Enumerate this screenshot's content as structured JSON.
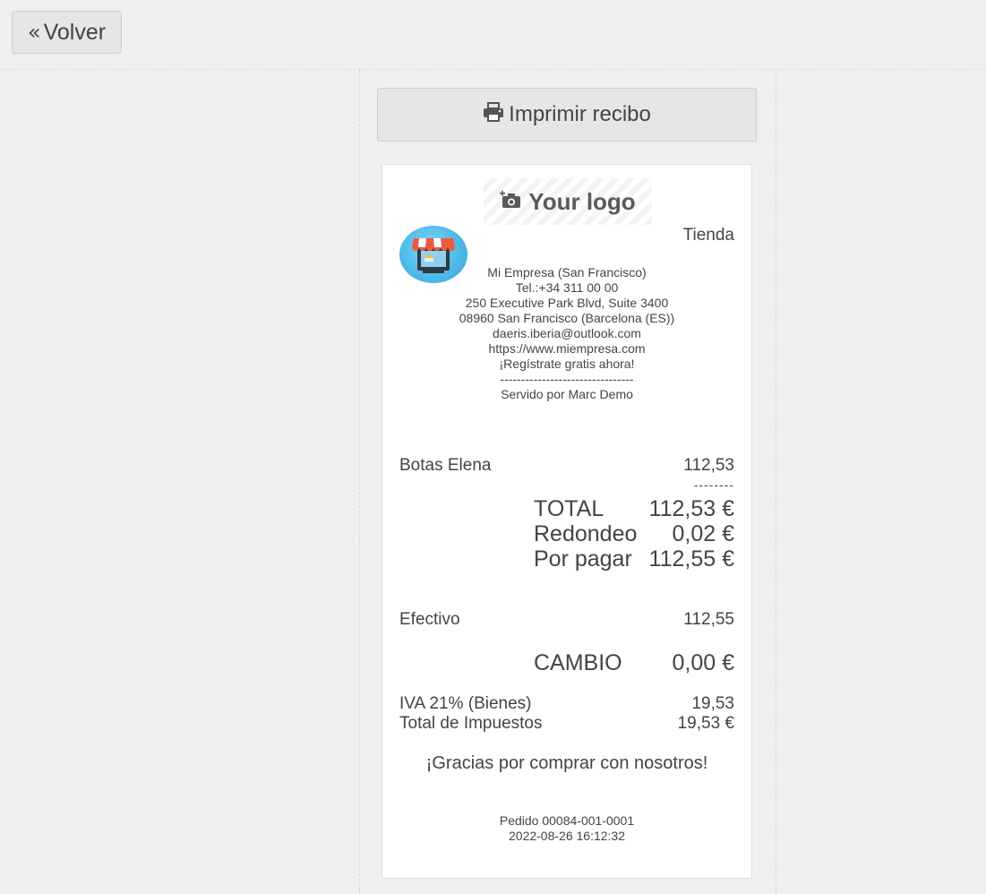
{
  "toolbar": {
    "back_label": "Volver",
    "back_icon": "double-chevron-left-icon"
  },
  "actions": {
    "print_label": "Imprimir recibo",
    "print_icon": "printer-icon"
  },
  "receipt": {
    "logo_placeholder": "Your logo",
    "store_name": "Tienda",
    "company": {
      "name": "Mi Empresa (San Francisco)",
      "phone": "Tel.:+34 311 00 00",
      "address1": "250 Executive Park Blvd, Suite 3400",
      "address2": "08960 San Francisco (Barcelona (ES))",
      "email": "daeris.iberia@outlook.com",
      "website": "https://www.miempresa.com",
      "promo": "¡Regístrate gratis ahora!",
      "separator": "--------------------------------",
      "served_by": "Servido por Marc Demo"
    },
    "lines": [
      {
        "product": "Botas Elena",
        "amount": "112,53"
      }
    ],
    "line_separator": "--------",
    "totals": {
      "total_label": "TOTAL",
      "total_value": "112,53 €",
      "rounding_label": "Redondeo",
      "rounding_value": "0,02 €",
      "to_pay_label": "Por pagar",
      "to_pay_value": "112,55 €"
    },
    "payment": {
      "method": "Efectivo",
      "amount": "112,55"
    },
    "change": {
      "label": "CAMBIO",
      "value": "0,00 €"
    },
    "taxes": {
      "tax_label": "IVA 21% (Bienes)",
      "tax_value": "19,53",
      "total_tax_label": "Total de Impuestos",
      "total_tax_value": "19,53 €"
    },
    "thanks": "¡Gracias por comprar con nosotros!",
    "order_ref": "Pedido 00084-001-0001",
    "datetime": "2022-08-26 16:12:32"
  },
  "colors": {
    "page_bg": "#f0eff0",
    "button_bg": "#e6e6e6",
    "receipt_bg": "#ffffff",
    "text": "#444444"
  }
}
